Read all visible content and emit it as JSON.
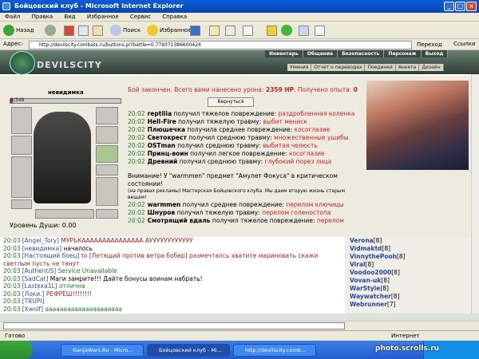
{
  "window": {
    "title": "Бойцовский клуб - Microsoft Internet Explorer"
  },
  "menu": [
    "Файл",
    "Правка",
    "Вид",
    "Избранное",
    "Сервис",
    "Справка"
  ],
  "toolbar": {
    "back": "Назад",
    "search": "Поиск",
    "favorites": "Избранное"
  },
  "address": {
    "label": "Адрес:",
    "url": "http://devilscity.combats.ru/buttons.pl?battle=0.779371386600424",
    "go": "Переход",
    "links": "Ссылки"
  },
  "game": {
    "logo_text": "DEVILSCITY",
    "nav_top": [
      "Инвентарь",
      "Общение",
      "Безопасность",
      "Персонаж",
      "Выход"
    ],
    "nav_sub": [
      "Умения",
      "Отчет о переводах",
      "Поединки",
      "Анкета",
      "Дизайн"
    ]
  },
  "character": {
    "name": "невидимка",
    "hp_text": "8/348",
    "hp_fraction": 0.023,
    "level_label": "Уровень",
    "level_value": "Души: 0.00"
  },
  "battle": {
    "result_text": "Бой закончен. Всего вами нанесено урона: ",
    "damage": "2359 HP",
    "exp_text": ". Получено опыта: ",
    "exp": "0",
    "return_button": "Вернуться",
    "log": [
      {
        "time": "20:02",
        "who": "reptilia",
        "text": " получил тяжелое повреждение: ",
        "injury": "раздробленная коленка"
      },
      {
        "time": "20:02",
        "who": "Hell-Fire",
        "text": " получил тяжелую травму: ",
        "injury": "выбит мениск"
      },
      {
        "time": "20:02",
        "who": "Плюшечка",
        "text": " получила среднее повреждение: ",
        "injury": "косоглазие"
      },
      {
        "time": "20:02",
        "who": "Светокрест",
        "text": " получил среднюю травму: ",
        "injury": "множественные ушибы"
      },
      {
        "time": "20:02",
        "who": "OSTman",
        "text": " получил среднюю травму: ",
        "injury": "выбитая челюсть"
      },
      {
        "time": "20:02",
        "who": "Принц-воин",
        "text": " получил легкое повреждение: ",
        "injury": "косоглазие"
      },
      {
        "time": "20:02",
        "who": "Древний",
        "text": " получил среднюю травму: ",
        "injury": "глубокий порез лица"
      }
    ],
    "notice": "Внимание! У \"warmmen\" предмет \"Амулет Фокуса\" в критическом состоянии!",
    "ad": "(на правах рекламы) Мастерская Бойцовского клуба. Мы даем вторую жизнь старым вещам!",
    "log2": [
      {
        "time": "20:02",
        "who": "warmmen",
        "text": " получил среднее повреждение: ",
        "injury": "перелом ключицы"
      },
      {
        "time": "20:02",
        "who": "Шнуров",
        "text": " получил тяжелую травму: ",
        "injury": "перелом голеностопа"
      },
      {
        "time": "20:02",
        "who": "Смотрящий вдаль",
        "text": " получил тяжелое повреждение: ",
        "injury": "перелом"
      }
    ]
  },
  "chat": [
    {
      "time": "20:03",
      "nick": "[Angel_Tory]",
      "msg": " МУРЬКААААААААААААААА АУУУУУУУУУУУУ",
      "color": "red"
    },
    {
      "time": "20:03",
      "nick": "[невидимка]",
      "msg": " началось",
      "color": ""
    },
    {
      "time": "20:03",
      "nick": "[Настоящий боец]",
      "msg": " to [Летящий против ветра бобер] размечталсь хватите мариновать скажи светлым пусть не тянут",
      "color": "red"
    },
    {
      "time": "20:03",
      "nick": "[AuthentiS]",
      "msg": " Service Unavailable",
      "color": "grn"
    },
    {
      "time": "20:03",
      "nick": "[SadCat]",
      "msg": " Маги замрите!!! Дайте бонусы воинам набрать!",
      "color": ""
    },
    {
      "time": "20:03",
      "nick": "[Lastexa1L]",
      "msg": " отлична",
      "color": "grn"
    },
    {
      "time": "20:03",
      "nick": "[Локи.]",
      "msg": " РЕФРЕШ!!!!!!!!",
      "color": "red"
    },
    {
      "time": "20:03",
      "nick": "[TRUPI]",
      "msg": "",
      "color": ""
    },
    {
      "time": "20:03",
      "nick": "[Xwolf]",
      "msg": " ааааааааааааааааааааа",
      "color": "grn"
    }
  ],
  "users": [
    {
      "name": "Verona",
      "lvl": "[8]"
    },
    {
      "name": "Vidmaktd",
      "lvl": "[8]"
    },
    {
      "name": "VinnythePooh",
      "lvl": "[8]"
    },
    {
      "name": "Viral",
      "lvl": "[8]"
    },
    {
      "name": "Voodoo2000",
      "lvl": "[8]"
    },
    {
      "name": "Vovan-uk",
      "lvl": "[8]"
    },
    {
      "name": "WarStyle",
      "lvl": "[8]"
    },
    {
      "name": "Waywatcher",
      "lvl": "[8]"
    },
    {
      "name": "Webrunner",
      "lvl": "[7]"
    }
  ],
  "status": {
    "left": "Готово",
    "right": "Интернет"
  },
  "taskbar": {
    "tasks": [
      "GanjaWars.Ru - Micro...",
      "Бойцовский клуб - Mi...",
      "http://devilscity.comb..."
    ],
    "clock": "20:03"
  },
  "watermark": "photo.scrolls.ru"
}
